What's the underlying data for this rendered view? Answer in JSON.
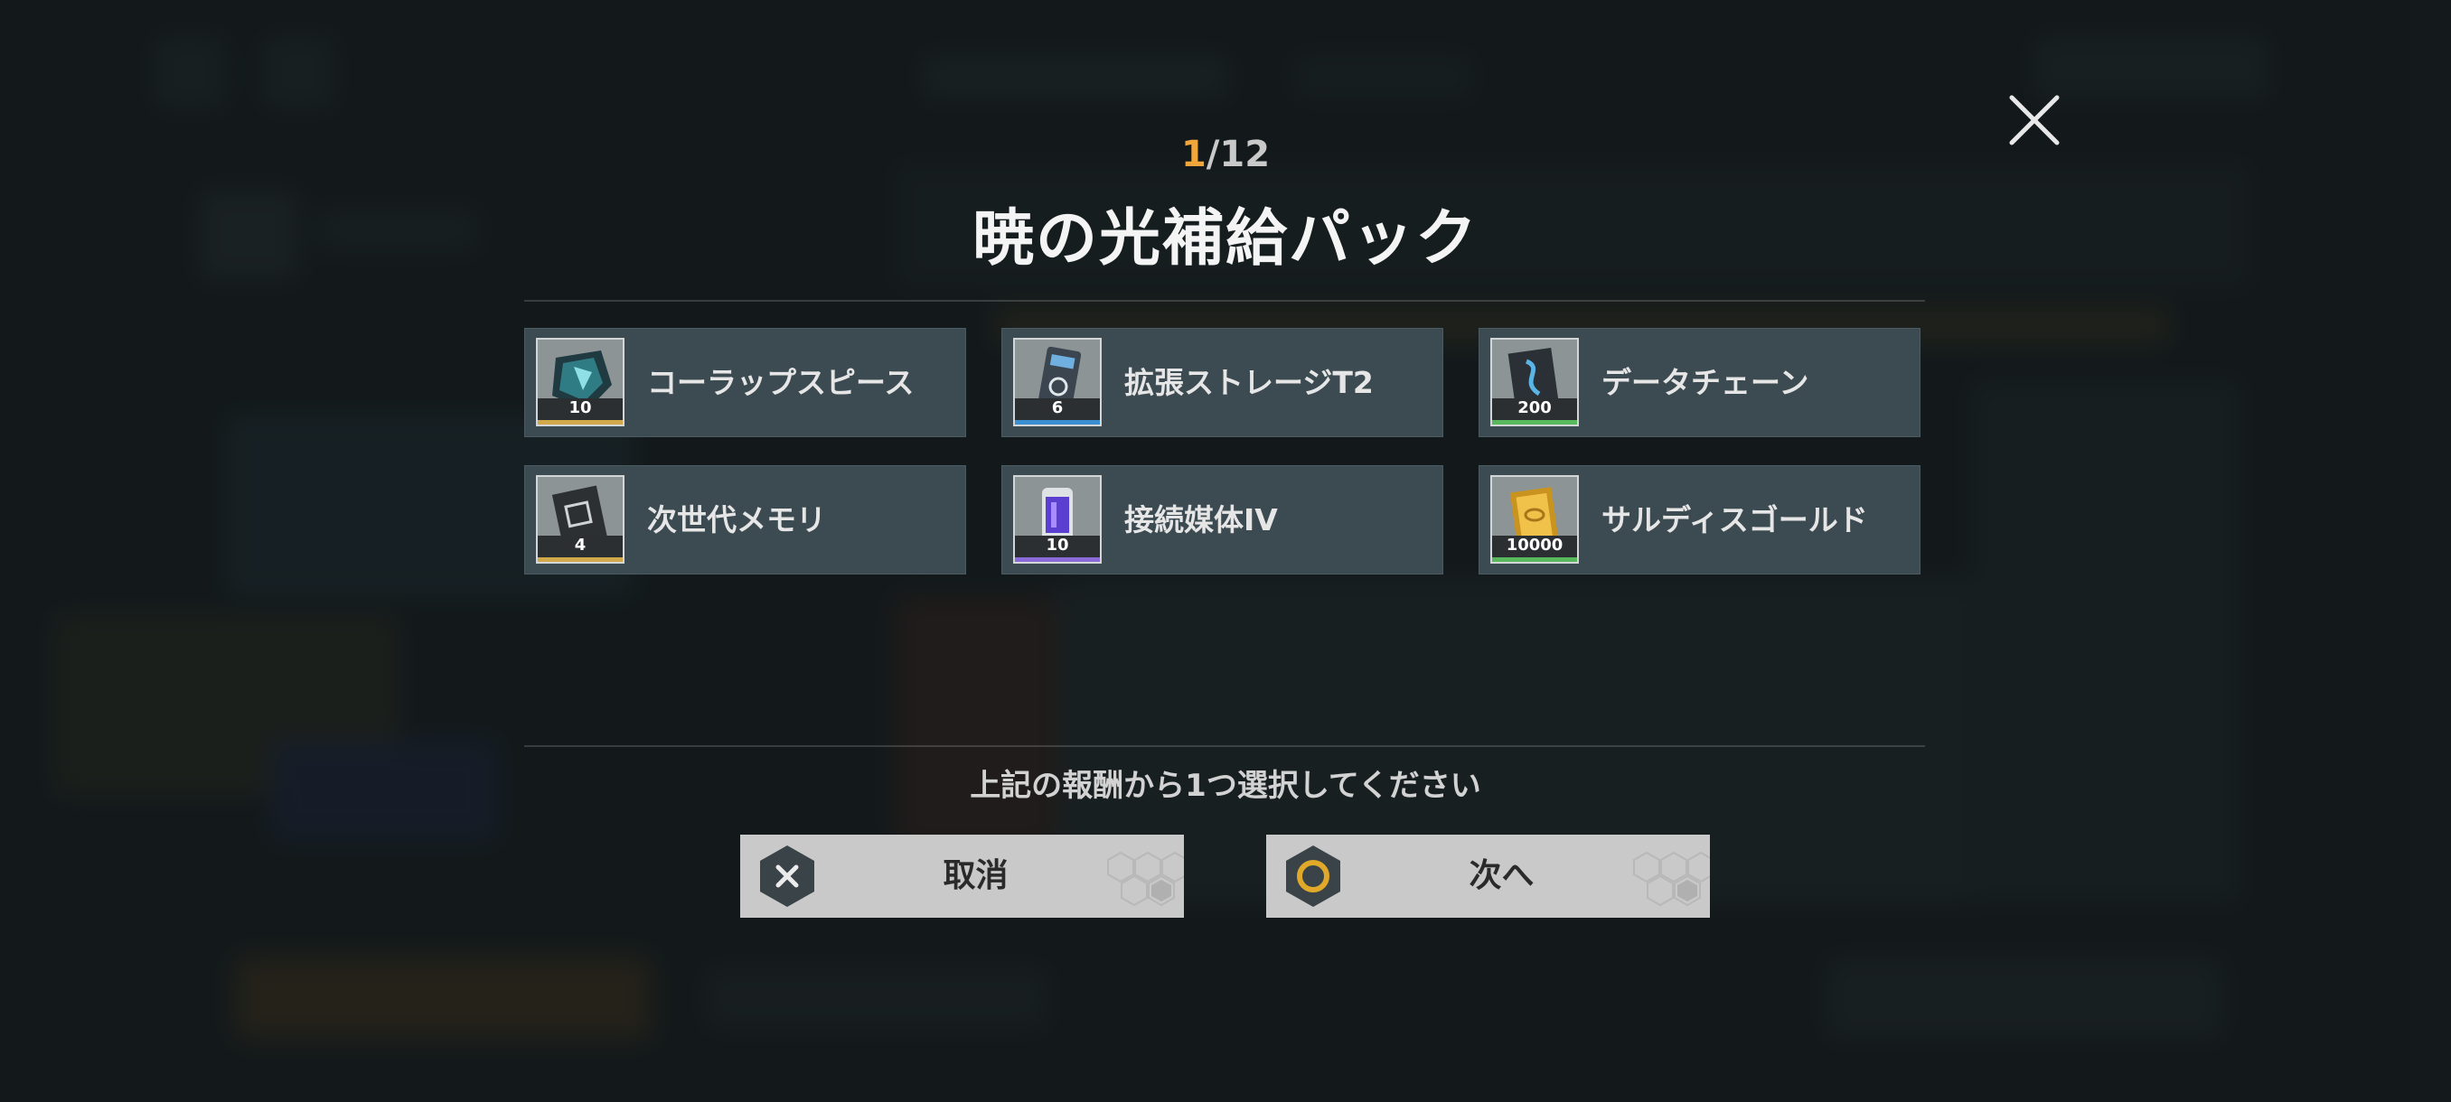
{
  "dialog": {
    "counter_current": "1",
    "counter_total": "/12",
    "title": "暁の光補給パック",
    "instruction": "上記の報酬から1つ選択してください"
  },
  "rewards": [
    {
      "name": "コーラップスピース",
      "quantity": "10",
      "icon": "collapse-piece-icon",
      "rarity_color": "#d1a84a"
    },
    {
      "name": "拡張ストレージT2",
      "quantity": "6",
      "icon": "expansion-storage-icon",
      "rarity_color": "#3b8fd1"
    },
    {
      "name": "データチェーン",
      "quantity": "200",
      "icon": "data-chain-icon",
      "rarity_color": "#58b85c"
    },
    {
      "name": "次世代メモリ",
      "quantity": "4",
      "icon": "next-gen-memory-icon",
      "rarity_color": "#d1a84a"
    },
    {
      "name": "接続媒体IV",
      "quantity": "10",
      "icon": "connection-medium-icon",
      "rarity_color": "#8a6ad9"
    },
    {
      "name": "サルディスゴールド",
      "quantity": "10000",
      "icon": "sardis-gold-icon",
      "rarity_color": "#58b85c"
    }
  ],
  "buttons": {
    "cancel_label": "取消",
    "next_label": "次へ"
  },
  "colors": {
    "accent_counter": "#f0a63a",
    "item_background": "#3c4a51",
    "button_background": "#c9c9c9",
    "next_icon_ring": "#e0a92a"
  }
}
